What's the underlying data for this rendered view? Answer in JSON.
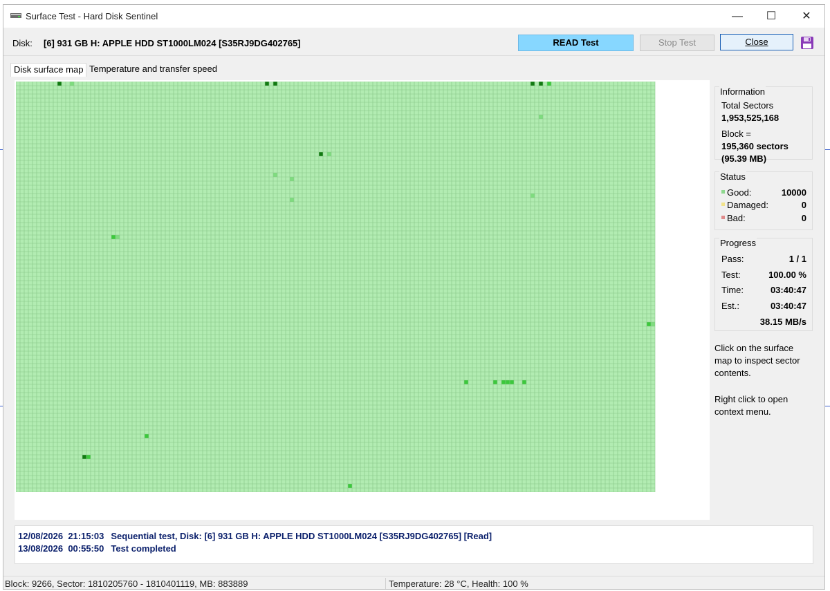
{
  "window": {
    "title": "Surface Test - Hard Disk Sentinel",
    "minimize_glyph": "—",
    "maximize_glyph": "☐",
    "close_glyph": "✕",
    "icon": "app-disk-icon"
  },
  "toolbar": {
    "disk_label": "Disk:",
    "disk_value": "[6] 931 GB H: APPLE HDD ST1000LM024 [S35RJ9DG402765]",
    "read_test_label": "READ Test",
    "stop_test_label": "Stop Test",
    "close_label": "Close",
    "save_icon": "floppy-disk-icon"
  },
  "tabs": [
    {
      "label": "Disk surface map",
      "active": true
    },
    {
      "label": "Temperature and transfer speed",
      "active": false
    }
  ],
  "surface_map": {
    "blocks_good": 10000,
    "colors": {
      "good": "#b2ecb2",
      "medium": "#7fdc7f",
      "strong": "#3cc83c",
      "dark": "#127a12",
      "grid": "#86c686"
    }
  },
  "sidebar": {
    "information": {
      "title": "Information",
      "total_sectors_label": "Total Sectors",
      "total_sectors_value": "1,953,525,168",
      "block_label": "Block =",
      "block_sectors": "195,360 sectors",
      "block_mb": "(95.39 MB)"
    },
    "status": {
      "title": "Status",
      "good_label": "Good:",
      "good_value": "10000",
      "damaged_label": "Damaged:",
      "damaged_value": "0",
      "bad_label": "Bad:",
      "bad_value": "0",
      "good_color": "#8fd88f",
      "damaged_color": "#f2e38a",
      "bad_color": "#e08a8a"
    },
    "progress": {
      "title": "Progress",
      "pass_label": "Pass:",
      "pass_value": "1 / 1",
      "test_label": "Test:",
      "test_value": "100.00 %",
      "time_label": "Time:",
      "time_value": "03:40:47",
      "est_label": "Est.:",
      "est_value": "03:40:47",
      "speed_value": "38.15 MB/s"
    },
    "hint_click": "Click on the surface map to inspect sector contents.",
    "hint_right_click": "Right click to open context menu."
  },
  "log": [
    {
      "date": "12/08/2026",
      "time": "21:15:03",
      "message": "Sequential test, Disk: [6] 931 GB H: APPLE HDD ST1000LM024 [S35RJ9DG402765] [Read]"
    },
    {
      "date": "13/08/2026",
      "time": "00:55:50",
      "message": "Test completed"
    }
  ],
  "statusbar": {
    "block_info": "Block: 9266, Sector: 1810205760 - 1810401119, MB: 883889",
    "temp_health": "Temperature: 28  °C, Health: 100 %"
  }
}
